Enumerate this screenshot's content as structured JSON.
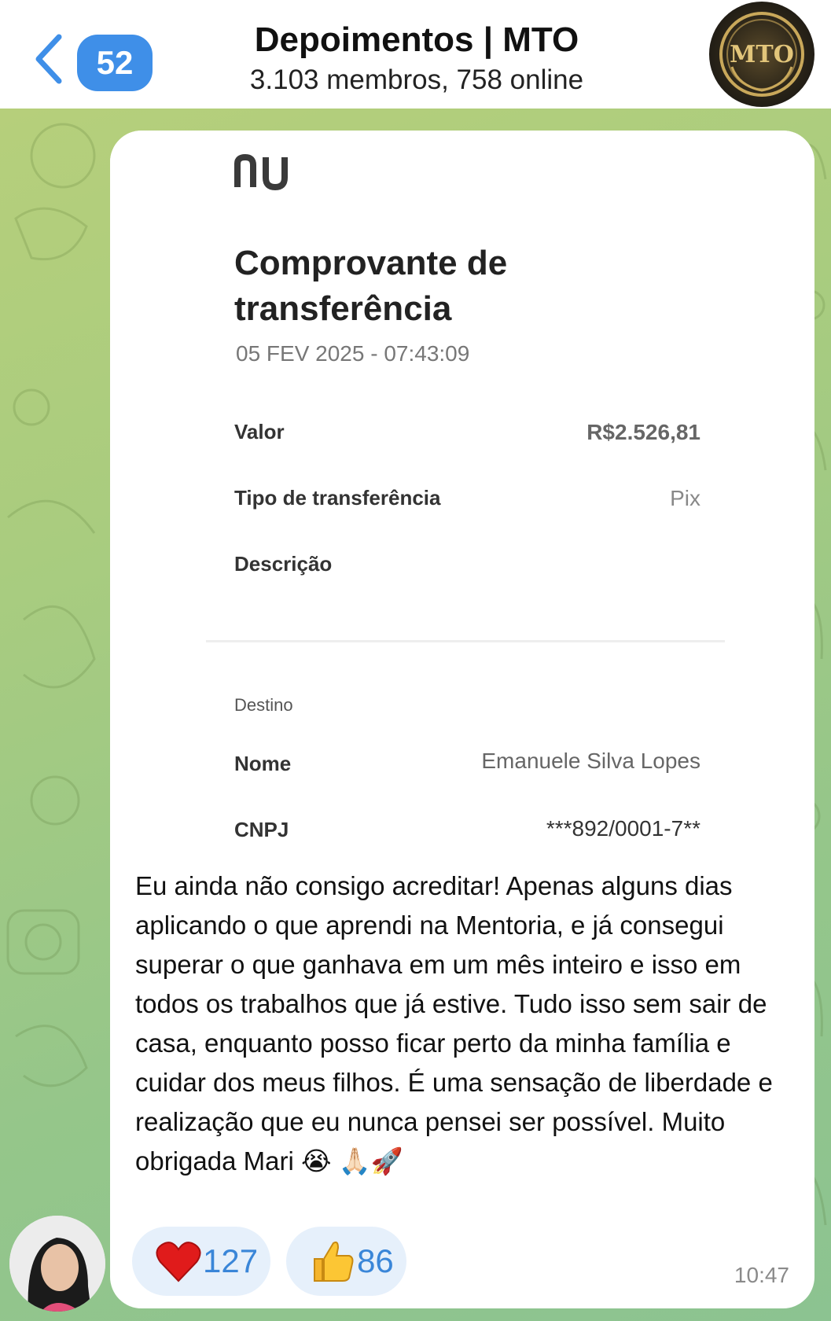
{
  "header": {
    "unread_count": "52",
    "title": "Depoimentos | MTO",
    "subtitle": "3.103 membros, 758 online",
    "logo_text": "MTO"
  },
  "receipt": {
    "logo_text": "nu",
    "title": "Comprovante de transferência",
    "date": "05 FEV 2025 - 07:43:09",
    "rows": [
      {
        "label": "Valor",
        "value": "R$2.526,81"
      },
      {
        "label": "Tipo de transferência",
        "value": "Pix"
      },
      {
        "label": "Descrição",
        "value": ""
      }
    ],
    "section": "Destino",
    "dest_rows": [
      {
        "label": "Nome",
        "value": "Emanuele Silva Lopes"
      },
      {
        "label": "CNPJ",
        "value": "***892/0001-7**"
      }
    ]
  },
  "message": {
    "text": "Eu ainda não consigo acreditar! Apenas alguns dias aplicando o que aprendi na Mentoria, e já consegui superar o que ganhava em um mês inteiro e isso em todos os trabalhos que já estive. Tudo isso sem sair de casa, enquanto posso ficar perto da minha família e cuidar dos meus filhos. É uma sensação de liberdade e realização que eu nunca pensei ser possível. Muito obrigada Mari 😭 🙏🏻🚀",
    "time": "10:47"
  },
  "reactions": [
    {
      "emoji": "heart-icon",
      "count": "127"
    },
    {
      "emoji": "thumbs-up-icon",
      "count": "86"
    }
  ],
  "colors": {
    "accent": "#3f8fe8",
    "reaction_bg": "#e6f0fb",
    "reaction_text": "#3a86d8",
    "chat_bg": "#a9cc7f"
  }
}
